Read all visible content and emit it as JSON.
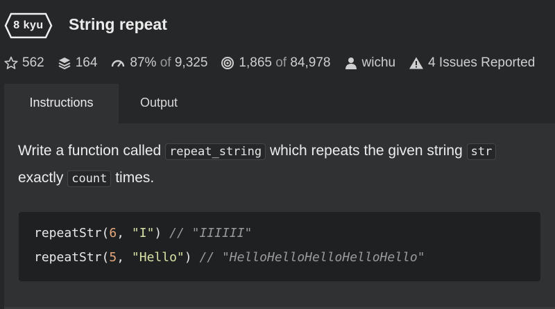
{
  "kata": {
    "rank": "8 kyu",
    "title": "String repeat"
  },
  "stats": {
    "stars": "562",
    "collections": "164",
    "satisfaction": "87%",
    "satisfaction_of": "of",
    "satisfaction_votes": "9,325",
    "completed": "1,865",
    "completed_of": "of",
    "completed_total": "84,978",
    "author": "wichu",
    "issues": "4 Issues Reported"
  },
  "tabs": {
    "instructions": "Instructions",
    "output": "Output"
  },
  "description": {
    "part1": "Write a function called ",
    "fn_name": "repeat_string",
    "part2": " which repeats the given string ",
    "param_str": "str",
    "part3": "exactly ",
    "param_count": "count",
    "part4": " times."
  },
  "code": {
    "line1": {
      "fn": "repeatStr(",
      "num": "6",
      "sep": ", ",
      "str": "\"I\"",
      "close": ") ",
      "comment": "// \"IIIIII\""
    },
    "line2": {
      "fn": "repeatStr(",
      "num": "5",
      "sep": ", ",
      "str": "\"Hello\"",
      "close": ") ",
      "comment": "// \"HelloHelloHelloHelloHello\""
    }
  },
  "icons": [
    "star-icon",
    "layers-icon",
    "gauge-icon",
    "target-icon",
    "user-icon",
    "warning-icon",
    "hexagon-badge-icon"
  ],
  "colors": {
    "background": "#262729",
    "panel": "#303133",
    "code_bg": "#1f2022",
    "number": "#e8a87c",
    "string": "#d9e2a6"
  }
}
